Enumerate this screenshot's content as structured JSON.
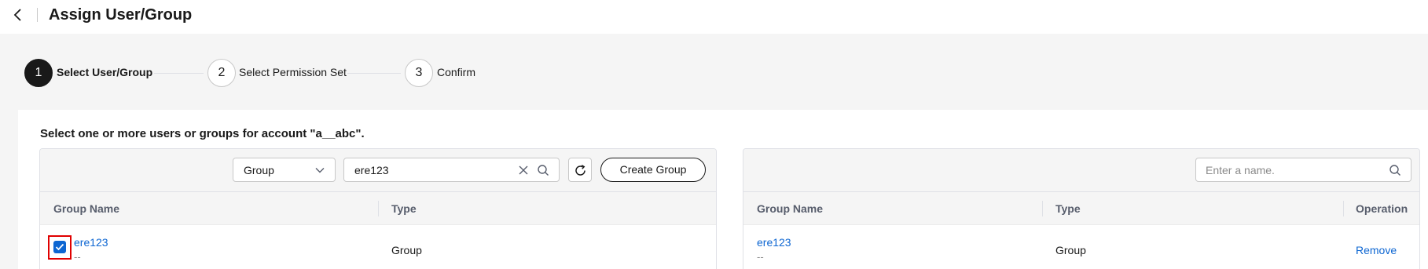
{
  "header": {
    "title": "Assign User/Group"
  },
  "steps": [
    {
      "number": "1",
      "label": "Select User/Group"
    },
    {
      "number": "2",
      "label": "Select Permission Set"
    },
    {
      "number": "3",
      "label": "Confirm"
    }
  ],
  "card": {
    "heading": "Select one or more users or groups for account \"a__abc\"."
  },
  "left_panel": {
    "type_select": "Group",
    "search_value": "ere123",
    "create_button": "Create Group",
    "columns": [
      "Group Name",
      "Type"
    ],
    "rows": [
      {
        "name": "ere123",
        "sub": "--",
        "type": "Group",
        "checked": true
      }
    ]
  },
  "right_panel": {
    "search_placeholder": "Enter a name.",
    "columns": [
      "Group Name",
      "Type",
      "Operation"
    ],
    "rows": [
      {
        "name": "ere123",
        "sub": "--",
        "type": "Group",
        "operation": "Remove"
      }
    ]
  },
  "colors": {
    "link": "#0d66d2",
    "checkbox": "#0d66d2",
    "highlight": "#e00000",
    "active_step": "#191919"
  },
  "icons": [
    "chevron-left-icon",
    "chevron-down-icon",
    "close-icon",
    "search-icon",
    "refresh-icon",
    "check-icon"
  ]
}
